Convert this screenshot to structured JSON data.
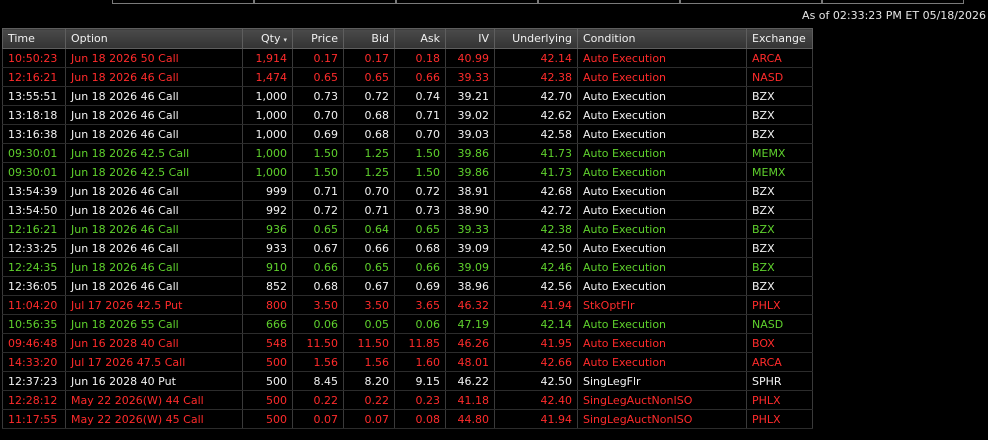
{
  "as_of": "As of 02:33:23 PM ET 05/18/2026",
  "columns": {
    "time": "Time",
    "option": "Option",
    "qty": "Qty",
    "qty_sort_icon": "▾",
    "price": "Price",
    "bid": "Bid",
    "ask": "Ask",
    "iv": "IV",
    "underlying": "Underlying",
    "condition": "Condition",
    "exchange": "Exchange"
  },
  "colors": {
    "red": "#ff2b2b",
    "green": "#5fd12d",
    "white": "#f2f2f2"
  },
  "rows": [
    {
      "color": "red",
      "time": "10:50:23",
      "option": "Jun 18 2026 50 Call",
      "qty": "1,914",
      "price": "0.17",
      "bid": "0.17",
      "ask": "0.18",
      "iv": "40.99",
      "underlying": "42.14",
      "condition": "Auto Execution",
      "exchange": "ARCA"
    },
    {
      "color": "red",
      "time": "12:16:21",
      "option": "Jun 18 2026 46 Call",
      "qty": "1,474",
      "price": "0.65",
      "bid": "0.65",
      "ask": "0.66",
      "iv": "39.33",
      "underlying": "42.38",
      "condition": "Auto Execution",
      "exchange": "NASD"
    },
    {
      "color": "white",
      "time": "13:55:51",
      "option": "Jun 18 2026 46 Call",
      "qty": "1,000",
      "price": "0.73",
      "bid": "0.72",
      "ask": "0.74",
      "iv": "39.21",
      "underlying": "42.70",
      "condition": "Auto Execution",
      "exchange": "BZX"
    },
    {
      "color": "white",
      "time": "13:18:18",
      "option": "Jun 18 2026 46 Call",
      "qty": "1,000",
      "price": "0.70",
      "bid": "0.68",
      "ask": "0.71",
      "iv": "39.02",
      "underlying": "42.62",
      "condition": "Auto Execution",
      "exchange": "BZX"
    },
    {
      "color": "white",
      "time": "13:16:38",
      "option": "Jun 18 2026 46 Call",
      "qty": "1,000",
      "price": "0.69",
      "bid": "0.68",
      "ask": "0.70",
      "iv": "39.03",
      "underlying": "42.58",
      "condition": "Auto Execution",
      "exchange": "BZX"
    },
    {
      "color": "green",
      "time": "09:30:01",
      "option": "Jun 18 2026 42.5 Call",
      "qty": "1,000",
      "price": "1.50",
      "bid": "1.25",
      "ask": "1.50",
      "iv": "39.86",
      "underlying": "41.73",
      "condition": "Auto Execution",
      "exchange": "MEMX"
    },
    {
      "color": "green",
      "time": "09:30:01",
      "option": "Jun 18 2026 42.5 Call",
      "qty": "1,000",
      "price": "1.50",
      "bid": "1.25",
      "ask": "1.50",
      "iv": "39.86",
      "underlying": "41.73",
      "condition": "Auto Execution",
      "exchange": "MEMX"
    },
    {
      "color": "white",
      "time": "13:54:39",
      "option": "Jun 18 2026 46 Call",
      "qty": "999",
      "price": "0.71",
      "bid": "0.70",
      "ask": "0.72",
      "iv": "38.91",
      "underlying": "42.68",
      "condition": "Auto Execution",
      "exchange": "BZX"
    },
    {
      "color": "white",
      "time": "13:54:50",
      "option": "Jun 18 2026 46 Call",
      "qty": "992",
      "price": "0.72",
      "bid": "0.71",
      "ask": "0.73",
      "iv": "38.90",
      "underlying": "42.72",
      "condition": "Auto Execution",
      "exchange": "BZX"
    },
    {
      "color": "green",
      "time": "12:16:21",
      "option": "Jun 18 2026 46 Call",
      "qty": "936",
      "price": "0.65",
      "bid": "0.64",
      "ask": "0.65",
      "iv": "39.33",
      "underlying": "42.38",
      "condition": "Auto Execution",
      "exchange": "BZX"
    },
    {
      "color": "white",
      "time": "12:33:25",
      "option": "Jun 18 2026 46 Call",
      "qty": "933",
      "price": "0.67",
      "bid": "0.66",
      "ask": "0.68",
      "iv": "39.09",
      "underlying": "42.50",
      "condition": "Auto Execution",
      "exchange": "BZX"
    },
    {
      "color": "green",
      "time": "12:24:35",
      "option": "Jun 18 2026 46 Call",
      "qty": "910",
      "price": "0.66",
      "bid": "0.65",
      "ask": "0.66",
      "iv": "39.09",
      "underlying": "42.46",
      "condition": "Auto Execution",
      "exchange": "BZX"
    },
    {
      "color": "white",
      "time": "12:36:05",
      "option": "Jun 18 2026 46 Call",
      "qty": "852",
      "price": "0.68",
      "bid": "0.67",
      "ask": "0.69",
      "iv": "38.96",
      "underlying": "42.56",
      "condition": "Auto Execution",
      "exchange": "BZX"
    },
    {
      "color": "red",
      "time": "11:04:20",
      "option": "Jul 17 2026 42.5 Put",
      "qty": "800",
      "price": "3.50",
      "bid": "3.50",
      "ask": "3.65",
      "iv": "46.32",
      "underlying": "41.94",
      "condition": "StkOptFlr",
      "exchange": "PHLX"
    },
    {
      "color": "green",
      "time": "10:56:35",
      "option": "Jun 18 2026 55 Call",
      "qty": "666",
      "price": "0.06",
      "bid": "0.05",
      "ask": "0.06",
      "iv": "47.19",
      "underlying": "42.14",
      "condition": "Auto Execution",
      "exchange": "NASD"
    },
    {
      "color": "red",
      "time": "09:46:48",
      "option": "Jun 16 2028 40 Call",
      "qty": "548",
      "price": "11.50",
      "bid": "11.50",
      "ask": "11.85",
      "iv": "46.26",
      "underlying": "41.95",
      "condition": "Auto Execution",
      "exchange": "BOX"
    },
    {
      "color": "red",
      "time": "14:33:20",
      "option": "Jul 17 2026 47.5 Call",
      "qty": "500",
      "price": "1.56",
      "bid": "1.56",
      "ask": "1.60",
      "iv": "48.01",
      "underlying": "42.66",
      "condition": "Auto Execution",
      "exchange": "ARCA"
    },
    {
      "color": "white",
      "time": "12:37:23",
      "option": "Jun 16 2028 40 Put",
      "qty": "500",
      "price": "8.45",
      "bid": "8.20",
      "ask": "9.15",
      "iv": "46.22",
      "underlying": "42.50",
      "condition": "SingLegFlr",
      "exchange": "SPHR"
    },
    {
      "color": "red",
      "time": "12:28:12",
      "option": "May 22 2026(W) 44 Call",
      "qty": "500",
      "price": "0.22",
      "bid": "0.22",
      "ask": "0.23",
      "iv": "41.18",
      "underlying": "42.40",
      "condition": "SingLegAuctNonISO",
      "exchange": "PHLX"
    },
    {
      "color": "red",
      "time": "11:17:55",
      "option": "May 22 2026(W) 45 Call",
      "qty": "500",
      "price": "0.07",
      "bid": "0.07",
      "ask": "0.08",
      "iv": "44.80",
      "underlying": "41.94",
      "condition": "SingLegAuctNonISO",
      "exchange": "PHLX"
    }
  ]
}
